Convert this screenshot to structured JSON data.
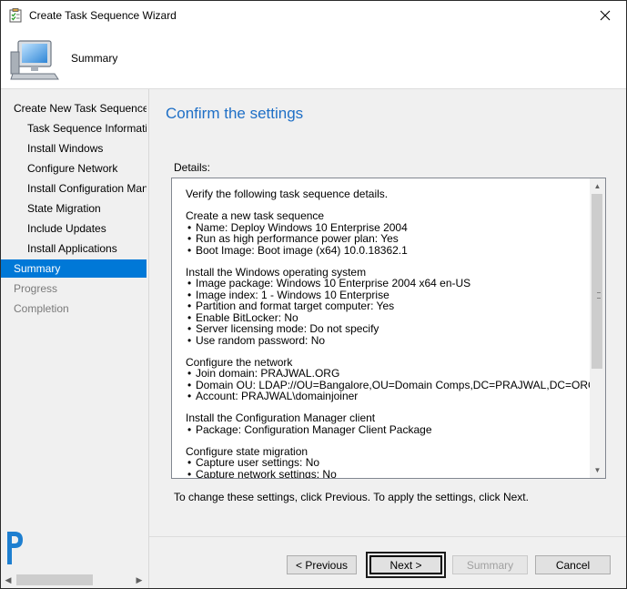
{
  "window": {
    "title": "Create Task Sequence Wizard"
  },
  "header": {
    "page_name": "Summary"
  },
  "nav": {
    "items": [
      {
        "label": "Create New Task Sequence",
        "level": 0,
        "state": "normal"
      },
      {
        "label": "Task Sequence Information",
        "level": 1,
        "state": "normal"
      },
      {
        "label": "Install Windows",
        "level": 1,
        "state": "normal"
      },
      {
        "label": "Configure Network",
        "level": 1,
        "state": "normal"
      },
      {
        "label": "Install Configuration Manager",
        "level": 1,
        "state": "normal"
      },
      {
        "label": "State Migration",
        "level": 1,
        "state": "normal"
      },
      {
        "label": "Include Updates",
        "level": 1,
        "state": "normal"
      },
      {
        "label": "Install Applications",
        "level": 1,
        "state": "normal"
      },
      {
        "label": "Summary",
        "level": 0,
        "state": "selected"
      },
      {
        "label": "Progress",
        "level": 0,
        "state": "disabled"
      },
      {
        "label": "Completion",
        "level": 0,
        "state": "disabled"
      }
    ]
  },
  "main": {
    "heading": "Confirm the settings",
    "details_label": "Details:",
    "details": {
      "intro": "Verify the following task sequence details.",
      "sections": [
        {
          "title": "Create a new task sequence",
          "items": [
            "Name: Deploy Windows 10 Enterprise 2004",
            "Run as high performance power plan: Yes",
            "Boot Image: Boot image (x64) 10.0.18362.1"
          ]
        },
        {
          "title": "Install the Windows operating system",
          "items": [
            "Image package: Windows 10 Enterprise 2004 x64 en-US",
            "Image index: 1 - Windows 10 Enterprise",
            "Partition and format target computer: Yes",
            "Enable BitLocker: No",
            "Server licensing mode: Do not specify",
            "Use random password: No"
          ]
        },
        {
          "title": "Configure the network",
          "items": [
            "Join domain: PRAJWAL.ORG",
            "Domain OU: LDAP://OU=Bangalore,OU=Domain Comps,DC=PRAJWAL,DC=ORG",
            "Account: PRAJWAL\\domainjoiner"
          ]
        },
        {
          "title": "Install the Configuration Manager client",
          "items": [
            "Package: Configuration Manager Client Package"
          ]
        },
        {
          "title": "Configure state migration",
          "items": [
            "Capture user settings: No",
            "Capture network settings: No"
          ]
        }
      ]
    },
    "footnote": "To change these settings, click Previous. To apply the settings, click Next."
  },
  "buttons": {
    "previous": "< Previous",
    "next": "Next >",
    "summary": "Summary",
    "cancel": "Cancel"
  },
  "icons": {
    "close": "close-icon",
    "app": "wizard-app-icon",
    "computer": "computer-icon",
    "logo": "brand-logo-icon"
  },
  "colors": {
    "accent": "#0078d7",
    "heading": "#1e6fc6",
    "logo": "#1e7fd0"
  }
}
